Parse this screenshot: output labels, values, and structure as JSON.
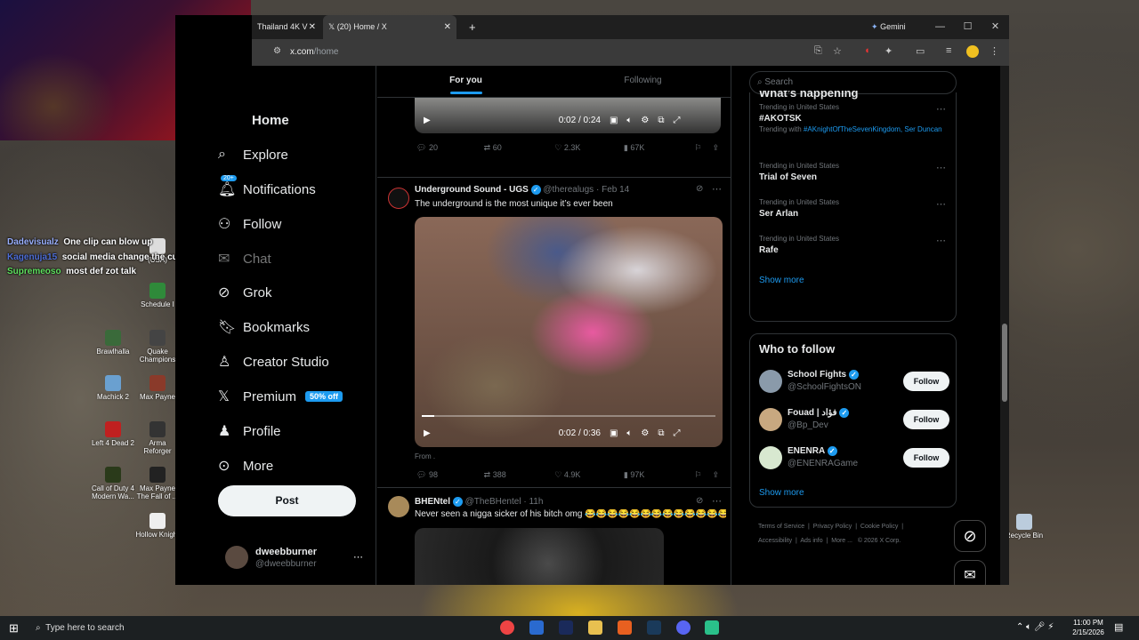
{
  "desktop": {
    "icons": [
      {
        "label": "(USA)"
      },
      {
        "label": "Schedule I"
      },
      {
        "label": "Brawlhalla"
      },
      {
        "label": "Quake Champions"
      },
      {
        "label": "Machick 2"
      },
      {
        "label": "Max Payne"
      },
      {
        "label": "Left 4 Dead 2"
      },
      {
        "label": "Arma Reforger"
      },
      {
        "label": "Call of Duty 4 Modern Wa..."
      },
      {
        "label": "Max Payne The Fall of ..."
      },
      {
        "label": "Hollow Knight"
      },
      {
        "label": "Recycle Bin"
      }
    ]
  },
  "stream_chat": [
    {
      "user": "Dadevisualz",
      "message": "One clip can blow up"
    },
    {
      "user": "Kagenuja15",
      "message": "social media change the culture for the best and worst"
    },
    {
      "user": "Supremeoso",
      "message": "most def zot talk"
    }
  ],
  "browser": {
    "tabs": [
      {
        "title": "Thailand 4K V"
      },
      {
        "title": "(20) Home / X"
      }
    ],
    "new_tab": "+",
    "gemini_label": "Gemini",
    "url_domain": "x.com",
    "url_path": "/home"
  },
  "sidebar": {
    "notification_badge": "20+",
    "items": [
      {
        "label": "Home",
        "icon": "home-icon"
      },
      {
        "label": "Explore",
        "icon": "search-icon"
      },
      {
        "label": "Notifications",
        "icon": "bell-icon"
      },
      {
        "label": "Follow",
        "icon": "person-add-icon"
      },
      {
        "label": "Chat",
        "icon": "chat-icon"
      },
      {
        "label": "Grok",
        "icon": "grok-icon"
      },
      {
        "label": "Bookmarks",
        "icon": "bookmark-icon"
      },
      {
        "label": "Creator Studio",
        "icon": "creator-icon"
      },
      {
        "label": "Premium",
        "icon": "x-logo-icon"
      },
      {
        "label": "Profile",
        "icon": "person-icon"
      },
      {
        "label": "More",
        "icon": "more-icon"
      }
    ],
    "premium_badge": "50% off",
    "post_button": "Post",
    "account": {
      "name": "dweebburner",
      "handle": "@dweebburner"
    }
  },
  "timeline": {
    "tabs": [
      "For you",
      "Following"
    ],
    "posts": [
      {
        "video_time": "0:02 / 0:24",
        "replies": "20",
        "reposts": "60",
        "likes": "2.3K",
        "views": "67K"
      },
      {
        "author": "Underground Sound - UGS",
        "handle": "@therealugs",
        "date": "Feb 14",
        "text": "The underground is the most unique it’s ever been",
        "video_time": "0:02 / 0:36",
        "from_label": "From",
        "replies": "98",
        "reposts": "388",
        "likes": "4.9K",
        "views": "97K"
      },
      {
        "author": "BHENtel",
        "handle": "@TheBHentel",
        "date": "11h",
        "text": "Never seen a nigga sicker of his bitch omg 😂😂😂😂😂😂😂😂😂😂😂😂😂"
      }
    ]
  },
  "right_column": {
    "search_placeholder": "Search",
    "whats_happening": "What’s happening",
    "trends": [
      {
        "meta": "Trending in United States",
        "name": "#AKOTSK",
        "trending_with_label": "Trending with",
        "trending_with": "#AKnightOfTheSevenKingdom, Ser Duncan"
      },
      {
        "meta": "Trending in United States",
        "name": "Trial of Seven"
      },
      {
        "meta": "Trending in United States",
        "name": "Ser Arlan"
      },
      {
        "meta": "Trending in United States",
        "name": "Rafe"
      }
    ],
    "show_more": "Show more",
    "who_to_follow_title": "Who to follow",
    "who_to_follow": [
      {
        "name": "School Fights",
        "handle": "@SchoolFightsON",
        "button": "Follow"
      },
      {
        "name": "Fouad | فؤاد",
        "handle": "@Bp_Dev",
        "button": "Follow"
      },
      {
        "name": "ENENRA",
        "handle": "@ENENRAGame",
        "button": "Follow"
      }
    ],
    "show_more_2": "Show more",
    "footer_links": [
      "Terms of Service",
      "Privacy Policy",
      "Cookie Policy",
      "Accessibility",
      "Ads info",
      "More ...",
      "© 2026 X Corp."
    ]
  },
  "taskbar": {
    "search_placeholder": "Type here to search",
    "time": "11:00 PM",
    "date": "2/15/2026"
  }
}
